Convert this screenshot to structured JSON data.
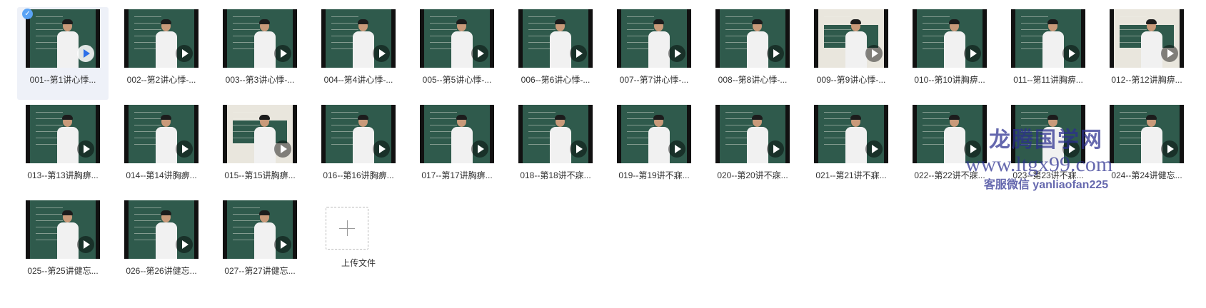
{
  "files": [
    {
      "name": "001--第1讲心悸...",
      "selected": true
    },
    {
      "name": "002--第2讲心悸-..."
    },
    {
      "name": "003--第3讲心悸-..."
    },
    {
      "name": "004--第4讲心悸-..."
    },
    {
      "name": "005--第5讲心悸-..."
    },
    {
      "name": "006--第6讲心悸-..."
    },
    {
      "name": "007--第7讲心悸-..."
    },
    {
      "name": "008--第8讲心悸-..."
    },
    {
      "name": "009--第9讲心悸-...",
      "light": true
    },
    {
      "name": "010--第10讲胸痹..."
    },
    {
      "name": "011--第11讲胸痹..."
    },
    {
      "name": "012--第12讲胸痹...",
      "light": true
    },
    {
      "name": "013--第13讲胸痹..."
    },
    {
      "name": "014--第14讲胸痹..."
    },
    {
      "name": "015--第15讲胸痹...",
      "light": true
    },
    {
      "name": "016--第16讲胸痹..."
    },
    {
      "name": "017--第17讲胸痹..."
    },
    {
      "name": "018--第18讲不寐..."
    },
    {
      "name": "019--第19讲不寐..."
    },
    {
      "name": "020--第20讲不寐..."
    },
    {
      "name": "021--第21讲不寐..."
    },
    {
      "name": "022--第22讲不寐..."
    },
    {
      "name": "023--第23讲不寐..."
    },
    {
      "name": "024--第24讲健忘..."
    },
    {
      "name": "025--第25讲健忘..."
    },
    {
      "name": "026--第26讲健忘..."
    },
    {
      "name": "027--第27讲健忘..."
    }
  ],
  "upload": {
    "label": "上传文件"
  },
  "watermark": {
    "title": "龙腾国学网",
    "url": "www.ltgx99.com",
    "contact": "客服微信 yanliaofan225"
  },
  "colors": {
    "selected_bg": "#eef1f8",
    "check": "#5aa3f5",
    "chalkboard": "#2f5a4c",
    "watermark": "#2b2f8f"
  }
}
